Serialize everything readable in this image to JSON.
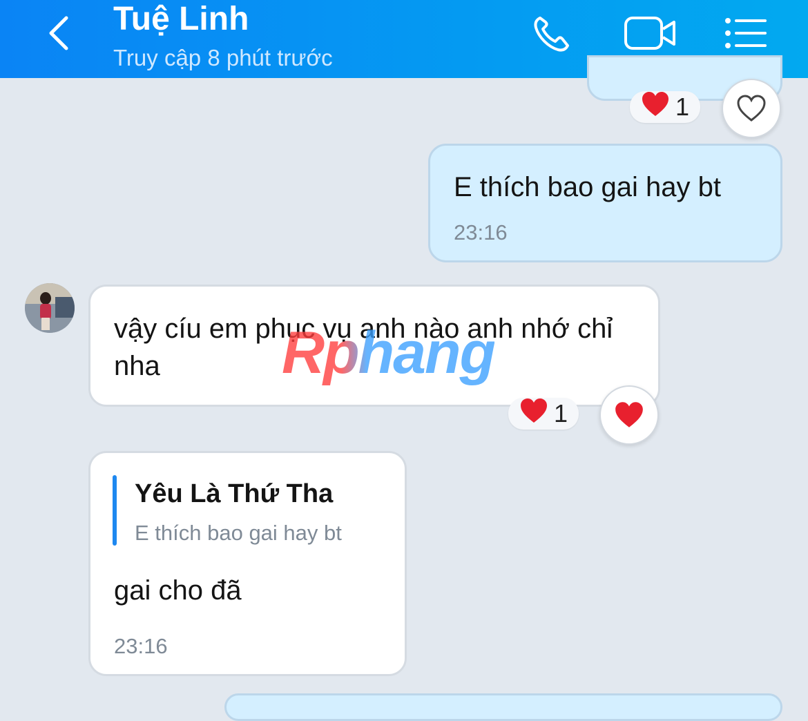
{
  "header": {
    "contact_name": "Tuệ Linh",
    "status": "Truy cập 8 phút trước"
  },
  "messages": [
    {
      "side": "mine",
      "text": "",
      "reaction": {
        "emoji": "❤️",
        "count": "1"
      }
    },
    {
      "side": "mine",
      "text": "E thích bao gai hay bt",
      "time": "23:16"
    },
    {
      "side": "theirs",
      "text": "vậy cíu em phục vụ anh nào anh nhớ chỉ nha",
      "reaction": {
        "emoji": "❤️",
        "count": "1"
      }
    },
    {
      "side": "theirs",
      "quote": {
        "author": "Yêu Là Thứ Tha",
        "text": "E thích bao gai hay bt"
      },
      "text": "gai cho đã",
      "time": "23:16"
    }
  ],
  "watermark": "Rphang",
  "colors": {
    "header": "#0a84f5",
    "mine_bubble": "#d4efff",
    "theirs_bubble": "#ffffff",
    "background": "#e2e8ef",
    "quote_bar": "#1e88f0",
    "heart": "#e8202e"
  },
  "icons": [
    "back-arrow-icon",
    "phone-icon",
    "video-camera-icon",
    "menu-list-icon",
    "heart-outline-icon",
    "heart-filled-icon"
  ]
}
